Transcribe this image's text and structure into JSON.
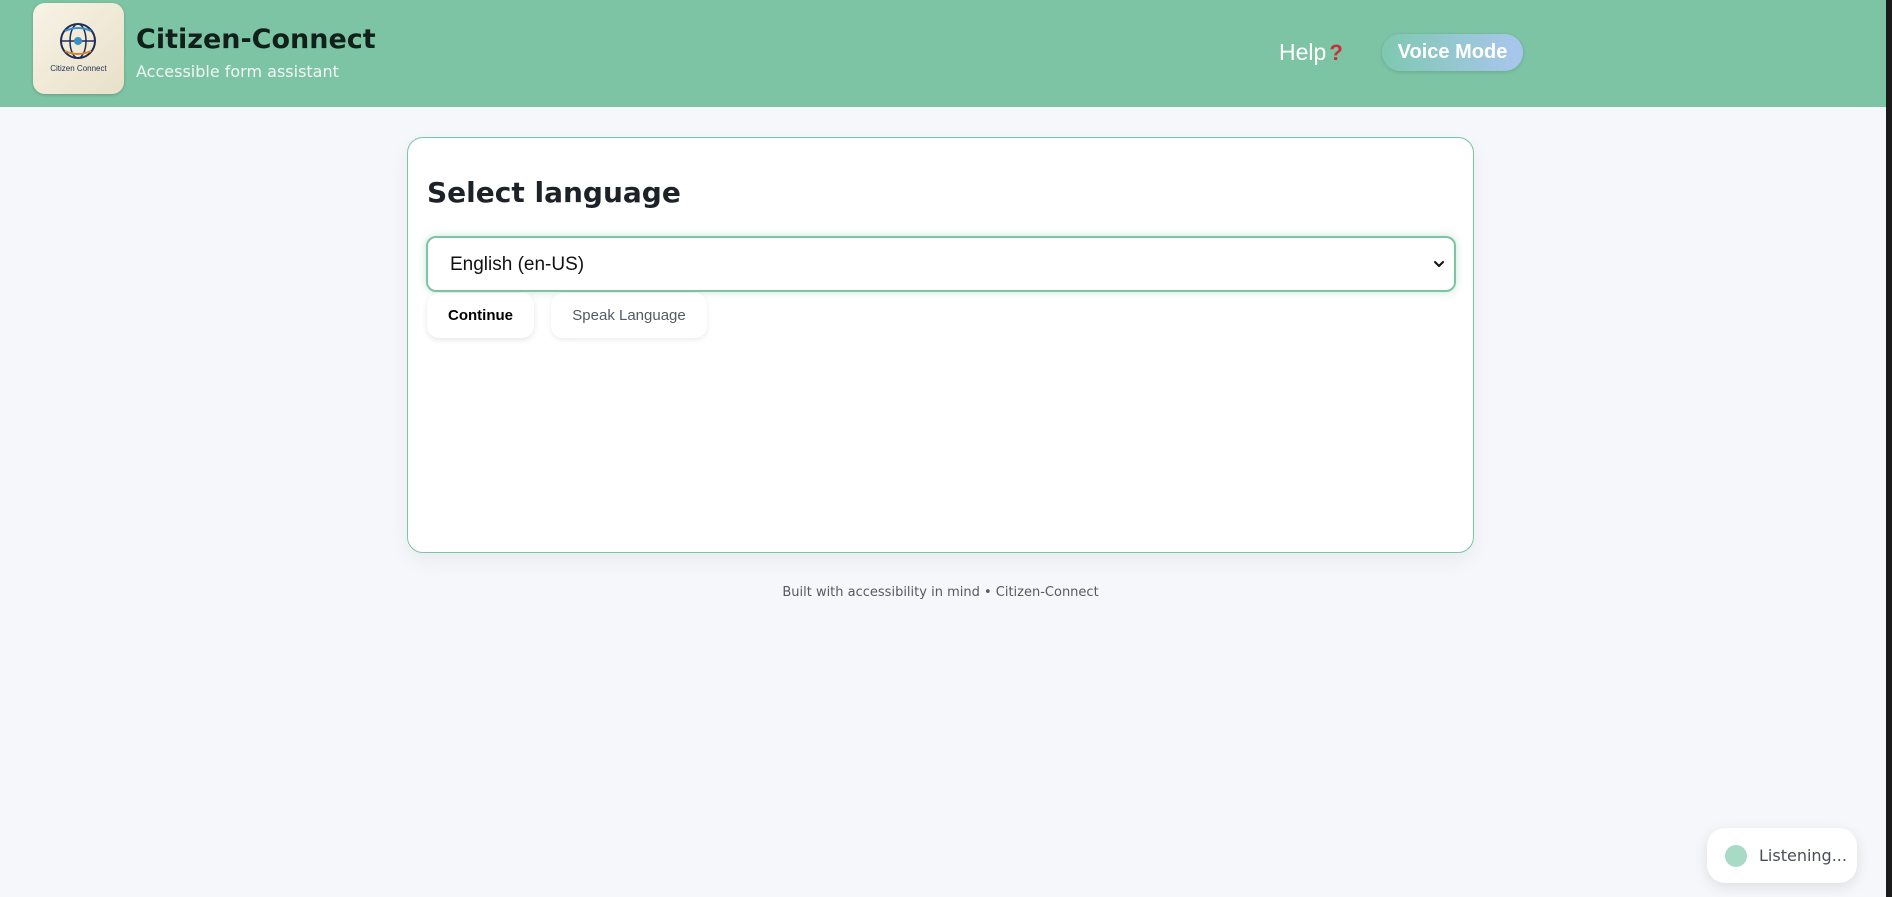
{
  "header": {
    "logo_text": "Citizen Connect",
    "title": "Citizen-Connect",
    "subtitle": "Accessible form assistant",
    "help_label": "Help",
    "help_icon": "?",
    "voice_mode_label": "Voice Mode"
  },
  "card": {
    "title": "Select language",
    "language_select": {
      "selected": "English (en-US)"
    },
    "continue_label": "Continue",
    "speak_language_label": "Speak Language"
  },
  "footer": {
    "text": "Built with accessibility in mind • Citizen-Connect"
  },
  "status": {
    "listening_label": "Listening..."
  },
  "colors": {
    "header_bg": "#7dc4a5",
    "accent": "#7dc4a5",
    "page_bg": "#f5f7fa",
    "help_icon": "#c9303a"
  }
}
